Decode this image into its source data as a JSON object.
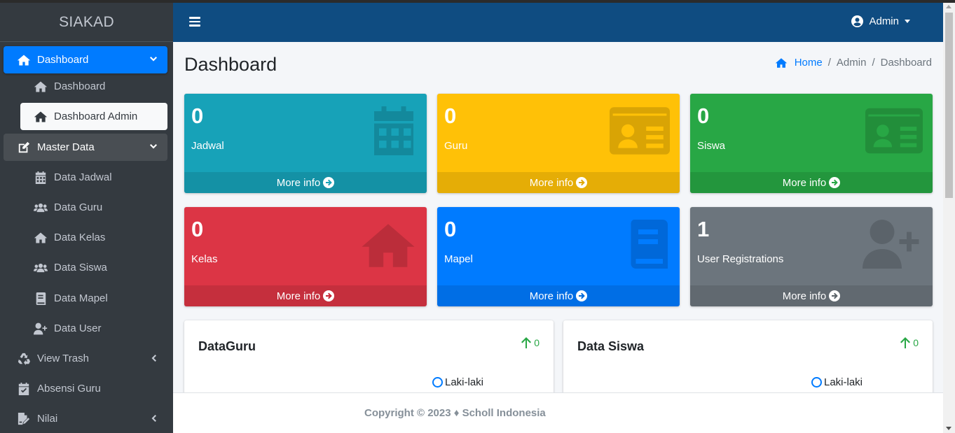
{
  "brand": "SIAKAD",
  "sidebar": {
    "items": [
      {
        "label": "Dashboard",
        "icon": "home-icon"
      },
      {
        "label": "Dashboard",
        "icon": "home-icon"
      },
      {
        "label": "Dashboard Admin",
        "icon": "home-icon"
      },
      {
        "label": "Master Data",
        "icon": "edit-icon"
      },
      {
        "label": "Data Jadwal",
        "icon": "calendar-icon"
      },
      {
        "label": "Data Guru",
        "icon": "users-icon"
      },
      {
        "label": "Data Kelas",
        "icon": "home-icon"
      },
      {
        "label": "Data Siswa",
        "icon": "users-icon"
      },
      {
        "label": "Data Mapel",
        "icon": "book-icon"
      },
      {
        "label": "Data User",
        "icon": "user-plus-icon"
      },
      {
        "label": "View Trash",
        "icon": "recycle-icon"
      },
      {
        "label": "Absensi Guru",
        "icon": "calendar-check-icon"
      },
      {
        "label": "Nilai",
        "icon": "file-signature-icon"
      }
    ]
  },
  "header": {
    "user": "Admin"
  },
  "page": {
    "title": "Dashboard",
    "breadcrumb": {
      "home": "Home",
      "b1": "Admin",
      "b2": "Dashboard"
    }
  },
  "boxes": [
    {
      "value": "0",
      "label": "Jadwal",
      "more": "More info",
      "color": "#17a2b8",
      "icon": "calendar-icon"
    },
    {
      "value": "0",
      "label": "Guru",
      "more": "More info",
      "color": "#ffc107",
      "icon": "id-card-icon"
    },
    {
      "value": "0",
      "label": "Siswa",
      "more": "More info",
      "color": "#28a745",
      "icon": "id-card-icon"
    },
    {
      "value": "0",
      "label": "Kelas",
      "more": "More info",
      "color": "#dc3545",
      "icon": "home-icon"
    },
    {
      "value": "0",
      "label": "Mapel",
      "more": "More info",
      "color": "#007bff",
      "icon": "book-icon"
    },
    {
      "value": "1",
      "label": "User Registrations",
      "more": "More info",
      "color": "#6c757d",
      "icon": "user-plus-icon"
    }
  ],
  "cards": [
    {
      "title": "DataGuru",
      "stat": "0",
      "legend": "Laki-laki"
    },
    {
      "title": "Data Siswa",
      "stat": "0",
      "legend": "Laki-laki"
    }
  ],
  "footer": "Copyright © 2023 ♦ Scholl Indonesia"
}
